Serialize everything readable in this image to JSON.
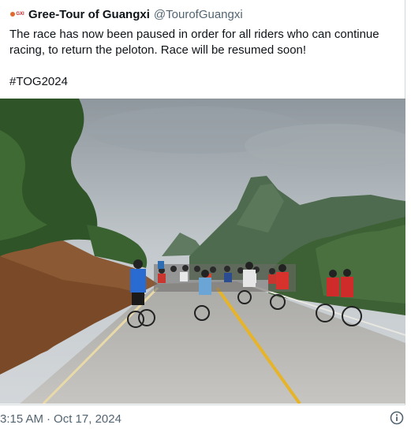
{
  "tweet": {
    "display_name": "Gree-Tour of Guangxi",
    "handle": "@TourofGuangxi",
    "avatar_icon": "tour-of-guangxi-logo-icon",
    "text": "The race has now been paused in order for all riders who can continue racing, to return the peloton. Race will be resumed soon!\n\n#TOG2024",
    "photo_icon": "race-photo-image",
    "time": "3:15 AM",
    "separator": "·",
    "date": "Oct 17, 2024",
    "info_icon": "info-icon"
  },
  "colors": {
    "text": "#0f1419",
    "secondary": "#536471",
    "border": "#cfd9de",
    "logo_red": "#c3272f"
  }
}
